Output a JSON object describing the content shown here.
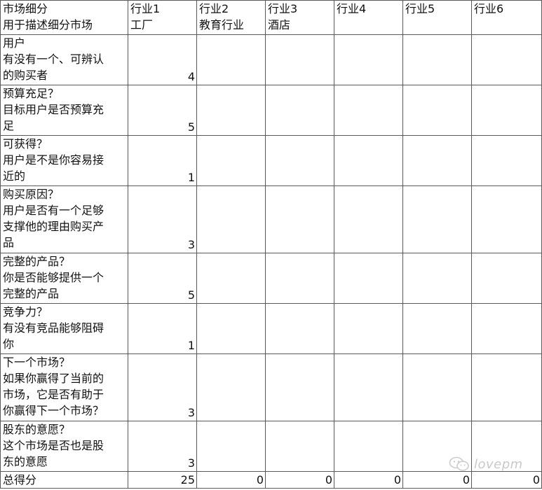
{
  "header": {
    "corner": [
      "市场细分",
      "用于描述细分市场"
    ],
    "industries": [
      {
        "name": "行业1",
        "sub": "工厂"
      },
      {
        "name": "行业2",
        "sub": "教育行业"
      },
      {
        "name": "行业3",
        "sub": "酒店"
      },
      {
        "name": "行业4",
        "sub": ""
      },
      {
        "name": "行业5",
        "sub": ""
      },
      {
        "name": "行业6",
        "sub": ""
      }
    ]
  },
  "rows": [
    {
      "lines": [
        "用户",
        "有没有一个、可辨认",
        "的购买者"
      ],
      "score": "4"
    },
    {
      "lines": [
        "预算充足？",
        "目标用户是否预算充",
        "足"
      ],
      "score": "5"
    },
    {
      "lines": [
        "可获得？",
        "用户是不是你容易接",
        "近的"
      ],
      "score": "1"
    },
    {
      "lines": [
        "购买原因？",
        "用户是否有一个足够",
        "支撑他的理由购买产",
        "品"
      ],
      "score": "3"
    },
    {
      "lines": [
        "完整的产品？",
        "你是否能够提供一个",
        "完整的产品"
      ],
      "score": "5"
    },
    {
      "lines": [
        "竞争力？",
        "有没有竞品能够阻碍",
        "你"
      ],
      "score": "1"
    },
    {
      "lines": [
        "下一个市场？",
        "如果你赢得了当前的",
        "市场，它是否有助于",
        "你赢得下一个市场？"
      ],
      "score": "3"
    },
    {
      "lines": [
        "股东的意愿？",
        "这个市场是否也是股",
        "东的意愿"
      ],
      "score": "3"
    }
  ],
  "total": {
    "label": "总得分",
    "values": [
      "25",
      "0",
      "0",
      "0",
      "0",
      "0"
    ]
  },
  "watermark": {
    "text": "lovepm",
    "icon": "wechat-icon"
  }
}
